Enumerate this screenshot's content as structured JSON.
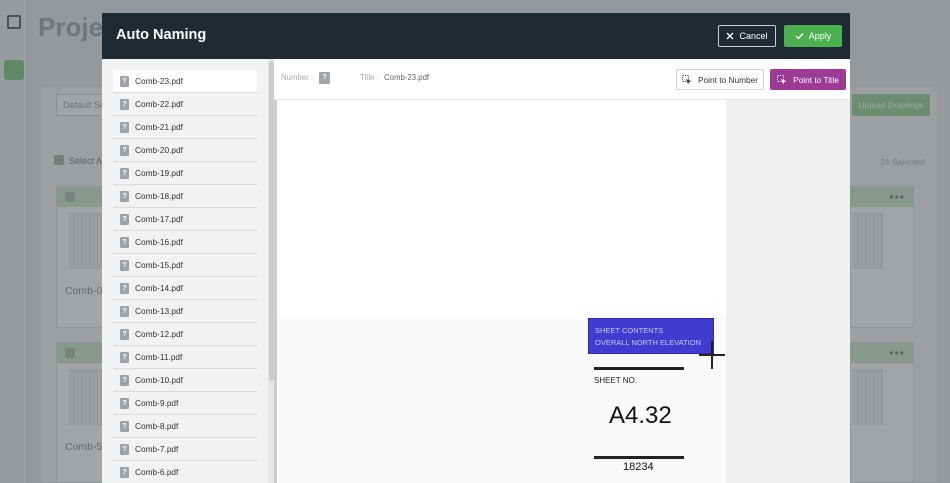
{
  "background": {
    "title": "Proje",
    "select_placeholder": "Default Se",
    "upload_button": "Upload Drawings",
    "select_all": "Select Al",
    "selected_count": "24 Selected",
    "cards": [
      {
        "name": "Comb-0"
      },
      {
        "name": "Comb-5"
      }
    ]
  },
  "modal": {
    "title": "Auto Naming",
    "cancel_label": "Cancel",
    "apply_label": "Apply",
    "files": [
      {
        "name": "Comb-23.pdf"
      },
      {
        "name": "Comb-22.pdf"
      },
      {
        "name": "Comb-21.pdf"
      },
      {
        "name": "Comb-20.pdf"
      },
      {
        "name": "Comb-19.pdf"
      },
      {
        "name": "Comb-18.pdf"
      },
      {
        "name": "Comb-17.pdf"
      },
      {
        "name": "Comb-16.pdf"
      },
      {
        "name": "Comb-15.pdf"
      },
      {
        "name": "Comb-14.pdf"
      },
      {
        "name": "Comb-13.pdf"
      },
      {
        "name": "Comb-12.pdf"
      },
      {
        "name": "Comb-11.pdf"
      },
      {
        "name": "Comb-10.pdf"
      },
      {
        "name": "Comb-9.pdf"
      },
      {
        "name": "Comb-8.pdf"
      },
      {
        "name": "Comb-7.pdf"
      },
      {
        "name": "Comb-6.pdf"
      }
    ],
    "file_icon_glyph": "?",
    "toolbar": {
      "number_label": "Number :",
      "number_value": "?",
      "title_label": "Title :",
      "title_value": "Comb-23.pdf",
      "point_to_number": "Point to Number",
      "point_to_title": "Point to Title"
    },
    "preview": {
      "highlight_line1": "SHEET CONTENTS",
      "highlight_line2": "OVERALL NORTH ELEVATION",
      "sheet_no_label": "SHEET NO.",
      "sheet_no_value": "A4.32",
      "sheet_sub_value": "18234"
    }
  },
  "colors": {
    "header": "#1f2a33",
    "apply": "#4cb050",
    "point_to_title": "#9c3a96",
    "highlight": "#3e3dcf"
  }
}
